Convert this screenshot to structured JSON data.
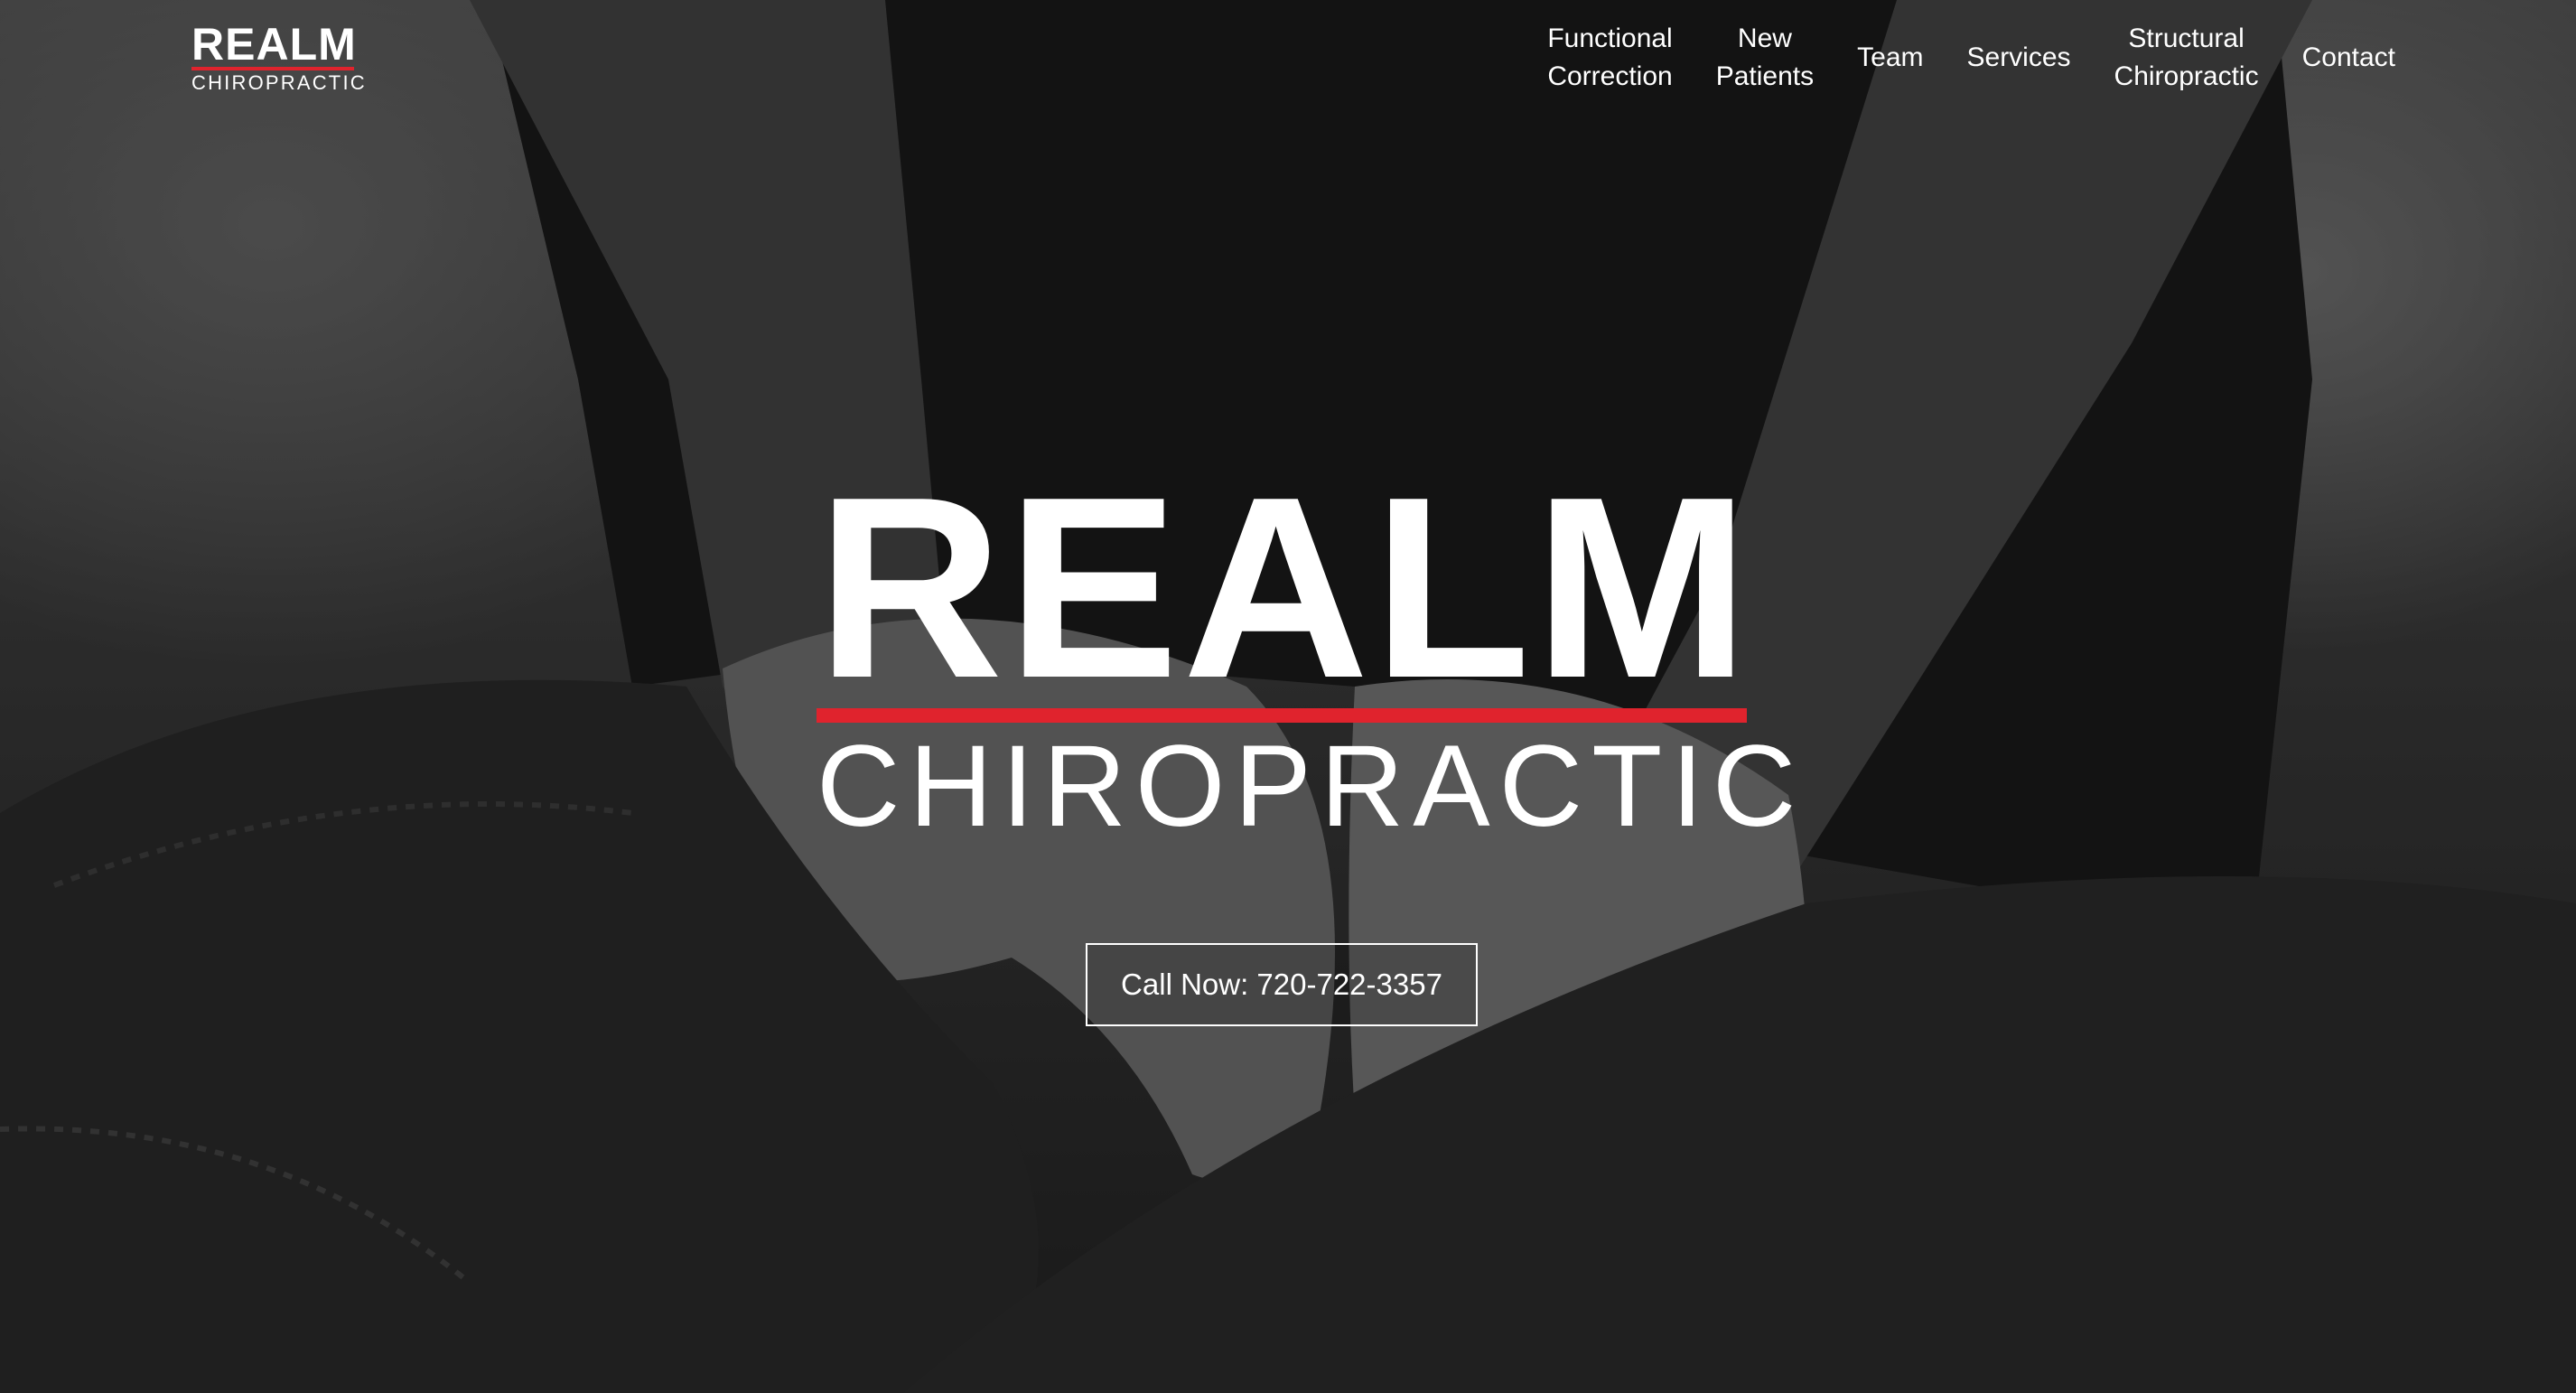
{
  "brand": {
    "name": "REALM",
    "tagline": "CHIROPRACTIC"
  },
  "nav": {
    "items": [
      {
        "line1": "Functional",
        "line2": "Correction"
      },
      {
        "line1": "New",
        "line2": "Patients"
      },
      {
        "line1": "Team",
        "line2": ""
      },
      {
        "line1": "Services",
        "line2": ""
      },
      {
        "line1": "Structural",
        "line2": "Chiropractic"
      },
      {
        "line1": "Contact",
        "line2": ""
      }
    ]
  },
  "hero": {
    "title": "REALM",
    "subtitle": "CHIROPRACTIC",
    "cta_label": "Call Now: 720-722-3357"
  },
  "colors": {
    "accent": "#e0232d",
    "text": "#ffffff"
  }
}
